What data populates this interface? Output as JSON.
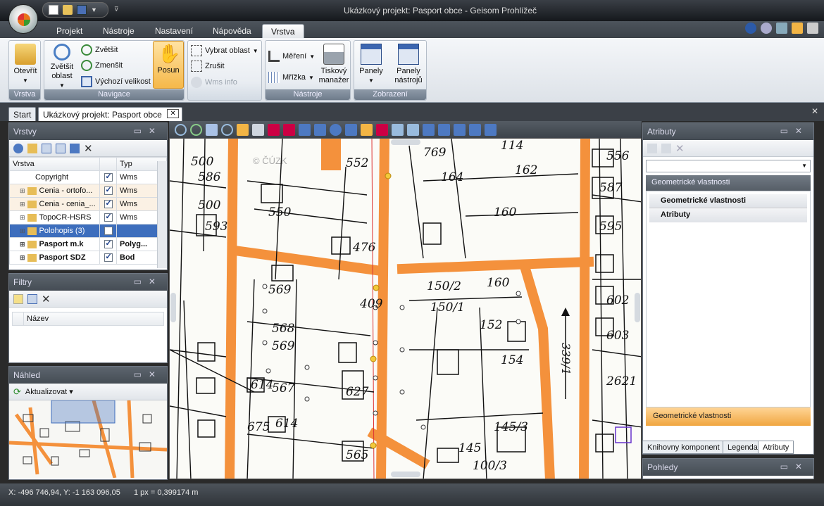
{
  "window": {
    "title": "Ukázkový projekt: Pasport obce - Geisom Prohlížeč"
  },
  "menu": {
    "tabs": [
      "Projekt",
      "Nástroje",
      "Nastavení",
      "Nápověda",
      "Vrstva"
    ],
    "active": "Vrstva"
  },
  "ribbon": {
    "vrstva": {
      "open_label": "Otevřít",
      "group_label": "Vrstva"
    },
    "navigace": {
      "zoom_area": "Zvětšit oblast",
      "zoom_in": "Zvětšit",
      "zoom_out": "Zmenšit",
      "default_size": "Výchozí velikost",
      "pan": "Posun",
      "group_label": "Navigace"
    },
    "select": {
      "select_area": "Vybrat oblast",
      "cancel": "Zrušit",
      "wms_info": "Wms info"
    },
    "nastroje": {
      "measure": "Měření",
      "grid": "Mřížka",
      "print_manager": "Tiskový manažer",
      "group_label": "Nástroje"
    },
    "zobrazeni": {
      "panels": "Panely",
      "tool_panels": "Panely nástrojů",
      "group_label": "Zobrazení"
    }
  },
  "doc_tabs": {
    "start": "Start",
    "project": "Ukázkový projekt: Pasport obce"
  },
  "layers_panel": {
    "title": "Vrstvy",
    "columns": [
      "Vrstva",
      "Typ"
    ],
    "rows": [
      {
        "name": "Copyright",
        "checked": true,
        "type": "Wms",
        "bold": false,
        "selected": false
      },
      {
        "name": "Cenia - ortofo...",
        "checked": true,
        "type": "Wms",
        "bold": false,
        "selected": false
      },
      {
        "name": "Cenia - cenia_...",
        "checked": true,
        "type": "Wms",
        "bold": false,
        "selected": false
      },
      {
        "name": "TopoCR-HSRS",
        "checked": true,
        "type": "Wms",
        "bold": false,
        "selected": false
      },
      {
        "name": "Polohopis (3)",
        "checked": false,
        "type": "",
        "bold": false,
        "selected": true
      },
      {
        "name": "Pasport m.k",
        "checked": true,
        "type": "Polyg...",
        "bold": true,
        "selected": false
      },
      {
        "name": "Pasport SDZ",
        "checked": true,
        "type": "Bod",
        "bold": true,
        "selected": false
      }
    ]
  },
  "filters_panel": {
    "title": "Filtry",
    "column": "Název"
  },
  "preview_panel": {
    "title": "Náhled",
    "refresh": "Aktualizovat"
  },
  "attributes_panel": {
    "title": "Atributy",
    "section_header": "Geometrické vlastnosti",
    "items": [
      "Geometrické vlastnosti",
      "Atributy"
    ],
    "footer": "Geometrické vlastnosti",
    "bottom_tabs": [
      "Knihovny komponent",
      "Legenda",
      "Atributy"
    ]
  },
  "views_panel": {
    "title": "Pohledy"
  },
  "status": {
    "coords": "X: -496 746,94, Y: -1 163 096,05",
    "scale": "1 px = 0,399174 m"
  },
  "map_labels": {
    "watermark": "© ČÚZK",
    "parcels": [
      "500",
      "552",
      "769",
      "114",
      "162",
      "556",
      "500",
      "164",
      "160",
      "587",
      "595",
      "593",
      "476",
      "550",
      "569",
      "150/2",
      "160",
      "152",
      "409",
      "568",
      "569",
      "614",
      "567",
      "627",
      "675",
      "614",
      "150/1",
      "154",
      "145/3",
      "145",
      "100/3",
      "565",
      "2621",
      "602",
      "603",
      "586"
    ],
    "road_code": "339/1"
  },
  "colors": {
    "road": "#f4913c",
    "accent": "#f7a849",
    "selection": "#3d6ebd"
  }
}
